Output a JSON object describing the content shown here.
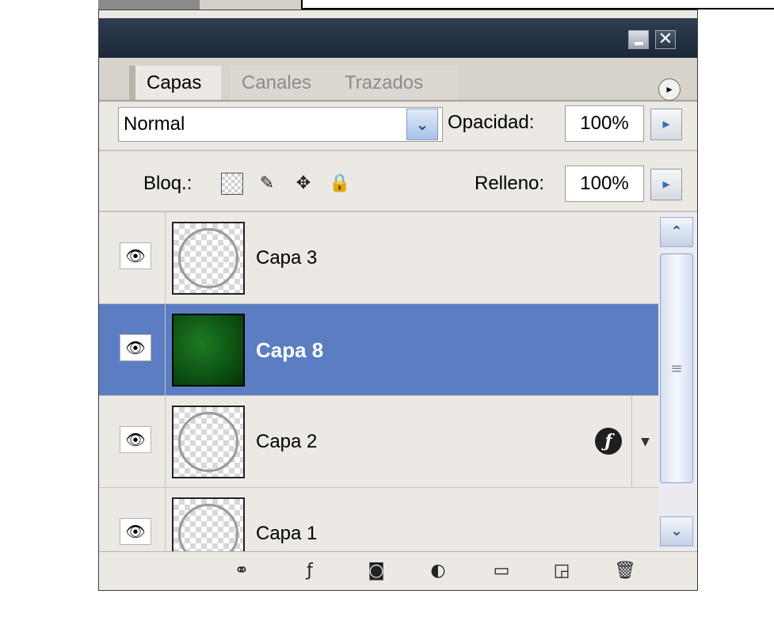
{
  "window": {
    "close_symbol": "✕"
  },
  "tabs": [
    {
      "label": "Capas",
      "active": true
    },
    {
      "label": "Canales",
      "active": false
    },
    {
      "label": "Trazados",
      "active": false
    }
  ],
  "panel_menu_symbol": "▸",
  "blend": {
    "mode": "Normal",
    "arrow_symbol": "⌄"
  },
  "opacity": {
    "label": "Opacidad:",
    "value": "100%"
  },
  "lock": {
    "label": "Bloq.:",
    "icons": [
      "lock-transparent-icon",
      "lock-image-icon",
      "lock-position-icon",
      "lock-all-icon"
    ]
  },
  "fill": {
    "label": "Relleno:",
    "value": "100%"
  },
  "flyout_symbol": "▸",
  "layers": [
    {
      "name": "Capa 3",
      "visible": true,
      "selected": false,
      "thumbnail": "transparent-circle",
      "has_effects": false
    },
    {
      "name": "Capa 8",
      "visible": true,
      "selected": true,
      "thumbnail": "green-texture",
      "has_effects": false
    },
    {
      "name": "Capa 2",
      "visible": true,
      "selected": false,
      "thumbnail": "transparent-circle",
      "has_effects": true
    },
    {
      "name": "Capa 1",
      "visible": true,
      "selected": false,
      "thumbnail": "transparent-circle",
      "has_effects": false
    }
  ],
  "colors": {
    "selected_row": "#5a7ec1",
    "titlebar": "#1c2838",
    "panel_bg": "#ece9e4"
  },
  "bottom_toolbar": [
    "link-layers-icon",
    "layer-style-icon",
    "layer-mask-icon",
    "adjustment-layer-icon",
    "new-group-icon",
    "new-layer-icon",
    "delete-layer-icon"
  ]
}
